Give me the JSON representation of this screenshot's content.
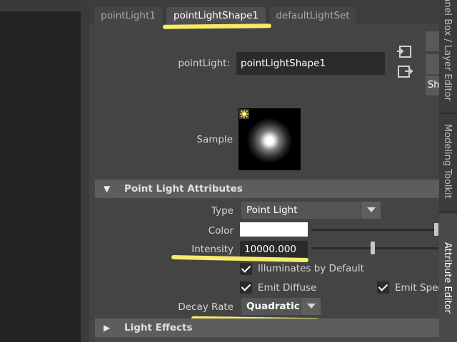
{
  "tabs": [
    "pointLight1",
    "pointLightShape1",
    "defaultLightSet"
  ],
  "header": {
    "node_label": "pointLight:",
    "node_value": "pointLightShape1",
    "sample_label": "Sample",
    "side_button_text": "Sh"
  },
  "sections": {
    "point_light_attributes": "Point Light Attributes",
    "light_effects": "Light Effects"
  },
  "attributes": {
    "type_label": "Type",
    "type_value": "Point Light",
    "color_label": "Color",
    "color_value": "#ffffff",
    "color_slider_level": 1.0,
    "intensity_label": "Intensity",
    "intensity_value": "10000.000",
    "intensity_slider_level": 0.48,
    "illuminates_label": "Illuminates by Default",
    "illuminates_checked": true,
    "emit_diffuse_label": "Emit Diffuse",
    "emit_diffuse_checked": true,
    "emit_specular_label": "Emit Specu",
    "emit_specular_checked": true,
    "decay_label": "Decay Rate",
    "decay_value": "Quadratic"
  },
  "right_tabs": [
    "nnel Box / Layer Editor",
    "Modeling Toolkit",
    "Attribute Editor"
  ],
  "highlight_color": "#fff56b",
  "icons": [
    "focus-input-icon",
    "focus-output-icon",
    "sample-light-icon",
    "collapse-arrow-icon",
    "expand-arrow-icon",
    "chevron-down-icon",
    "checkmark-icon"
  ]
}
